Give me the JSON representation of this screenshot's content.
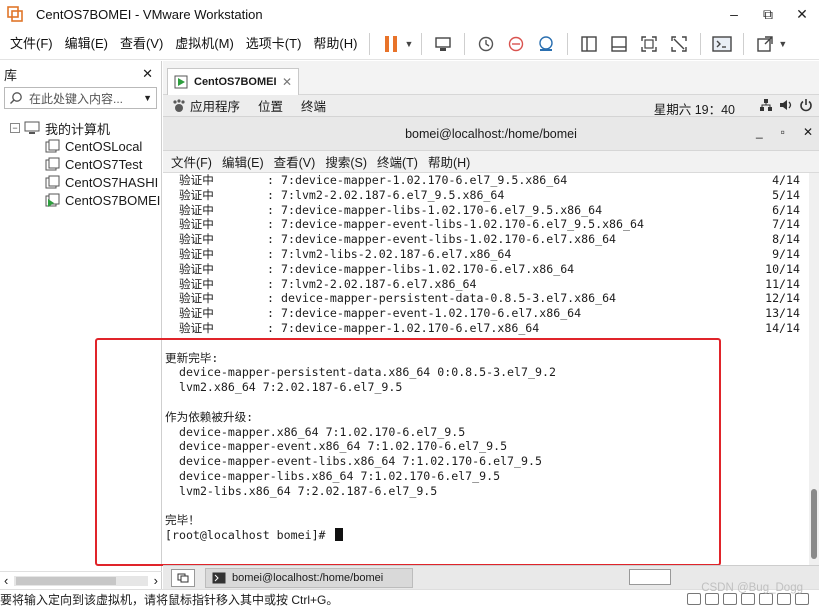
{
  "window": {
    "title": "CentOS7BOMEI - VMware Workstation",
    "controls": [
      "–",
      "⧉",
      "✕"
    ]
  },
  "menubar": {
    "items": [
      "文件(F)",
      "编辑(E)",
      "查看(V)",
      "虚拟机(M)",
      "选项卡(T)",
      "帮助(H)"
    ]
  },
  "toolbar": {
    "icons": [
      "pause-icon",
      "send-keys-icon",
      "snapshot-icon",
      "revert-snapshot-icon",
      "snapshot-manager-icon",
      "library-view-icon",
      "thumbnail-view-icon",
      "fullscreen-icon",
      "unity-icon",
      "console-icon",
      "stretch-icon"
    ]
  },
  "library": {
    "title": "库",
    "close": "✕",
    "search_placeholder": "在此处键入内容...",
    "root": "我的计算机",
    "vms": [
      "CentOSLocal",
      "CentOS7Test",
      "CentOS7HASHI",
      "CentOS7BOMEI"
    ],
    "scroll_left": "‹",
    "scroll_right": "›"
  },
  "tab": {
    "label": "CentOS7BOMEI",
    "close": "✕"
  },
  "gnome": {
    "apps": "应用程序",
    "places": "位置",
    "terminal": "终端",
    "clock": "星期六 19：40"
  },
  "terminal": {
    "title": "bomei@localhost:/home/bomei",
    "controls": [
      "_",
      "▫",
      "✕"
    ],
    "menu": [
      "文件(F)",
      "编辑(E)",
      "查看(V)",
      "搜索(S)",
      "终端(T)",
      "帮助(H)"
    ],
    "verify_rows": [
      {
        "label": "验证中",
        "colon": ":",
        "pkg": "7:device-mapper-1.02.170-6.el7_9.5.x86_64",
        "count": "4/14"
      },
      {
        "label": "验证中",
        "colon": ":",
        "pkg": "7:lvm2-2.02.187-6.el7_9.5.x86_64",
        "count": "5/14"
      },
      {
        "label": "验证中",
        "colon": ":",
        "pkg": "7:device-mapper-libs-1.02.170-6.el7_9.5.x86_64",
        "count": "6/14"
      },
      {
        "label": "验证中",
        "colon": ":",
        "pkg": "7:device-mapper-event-libs-1.02.170-6.el7_9.5.x86_64",
        "count": "7/14"
      },
      {
        "label": "验证中",
        "colon": ":",
        "pkg": "7:device-mapper-event-libs-1.02.170-6.el7.x86_64",
        "count": "8/14"
      },
      {
        "label": "验证中",
        "colon": ":",
        "pkg": "7:lvm2-libs-2.02.187-6.el7.x86_64",
        "count": "9/14"
      },
      {
        "label": "验证中",
        "colon": ":",
        "pkg": "7:device-mapper-libs-1.02.170-6.el7.x86_64",
        "count": "10/14"
      },
      {
        "label": "验证中",
        "colon": ":",
        "pkg": "7:lvm2-2.02.187-6.el7.x86_64",
        "count": "11/14"
      },
      {
        "label": "验证中",
        "colon": ":",
        "pkg": "device-mapper-persistent-data-0.8.5-3.el7.x86_64",
        "count": "12/14"
      },
      {
        "label": "验证中",
        "colon": ":",
        "pkg": "7:device-mapper-event-1.02.170-6.el7.x86_64",
        "count": "13/14"
      },
      {
        "label": "验证中",
        "colon": ":",
        "pkg": "7:device-mapper-1.02.170-6.el7.x86_64",
        "count": "14/14"
      }
    ],
    "updated_heading": "更新完毕:",
    "updated": [
      "device-mapper-persistent-data.x86_64 0:0.8.5-3.el7_9.2",
      "lvm2.x86_64 7:2.02.187-6.el7_9.5"
    ],
    "deps_heading": "作为依赖被升级:",
    "deps": [
      "device-mapper.x86_64 7:1.02.170-6.el7_9.5",
      "device-mapper-event.x86_64 7:1.02.170-6.el7_9.5",
      "device-mapper-event-libs.x86_64 7:1.02.170-6.el7_9.5",
      "device-mapper-libs.x86_64 7:1.02.170-6.el7_9.5",
      "lvm2-libs.x86_64 7:2.02.187-6.el7_9.5"
    ],
    "done": "完毕！",
    "prompt": "[root@localhost bomei]# "
  },
  "taskbar": {
    "task_label": "bomei@localhost:/home/bomei"
  },
  "status": {
    "message": "要将输入定向到该虚拟机，请将鼠标指针移入其中或按 Ctrl+G。"
  },
  "watermark": "CSDN @Bug_Dogg",
  "colors": {
    "highlight_border": "#e0242a",
    "pause_icon": "#e8732a"
  }
}
